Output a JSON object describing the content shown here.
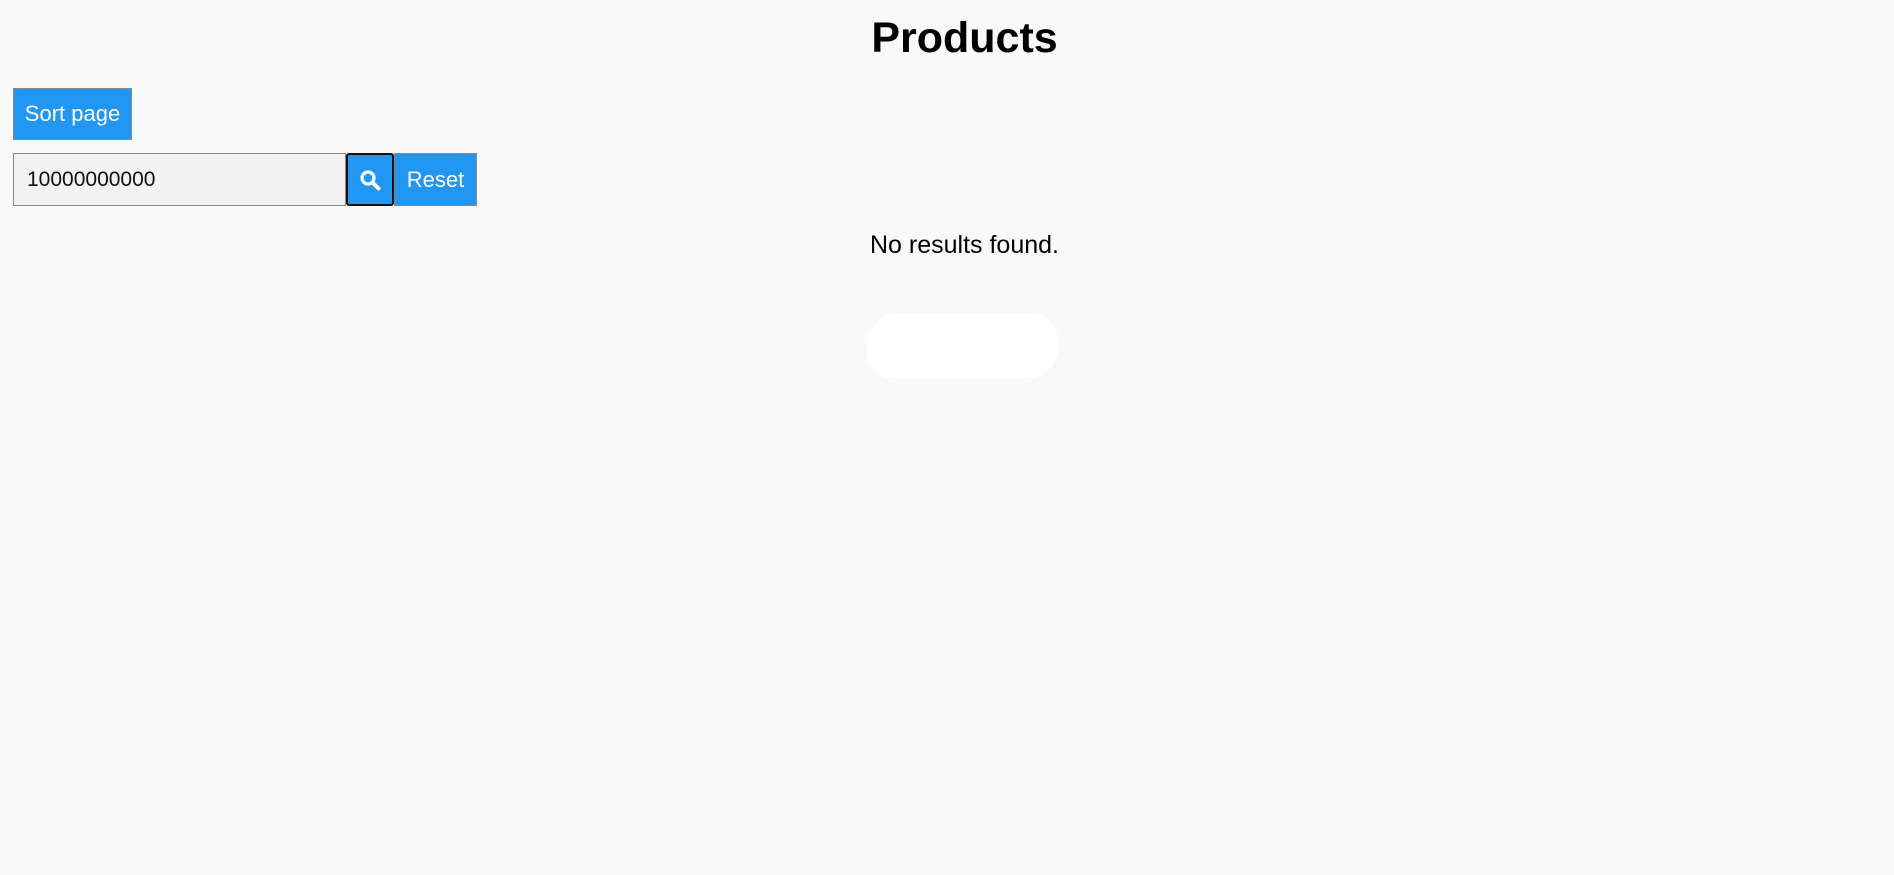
{
  "page": {
    "title": "Products"
  },
  "toolbar": {
    "sort_label": "Sort page"
  },
  "search": {
    "value": "10000000000",
    "placeholder": "",
    "search_icon": "search-icon",
    "reset_label": "Reset"
  },
  "results": {
    "empty_message": "No results found."
  },
  "colors": {
    "accent": "#2196f3",
    "background": "#f9f9fa",
    "input_background": "#f2f2f2"
  }
}
